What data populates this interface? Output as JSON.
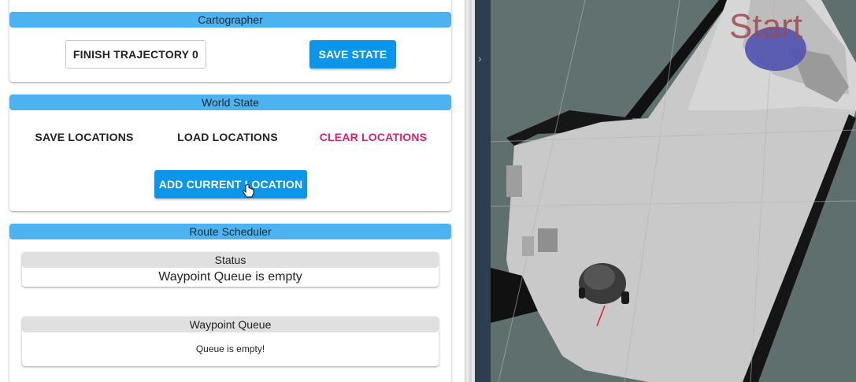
{
  "cartographer": {
    "title": "Cartographer",
    "finish_trajectory_label": "FINISH TRAJECTORY 0",
    "save_state_label": "SAVE STATE"
  },
  "world_state": {
    "title": "World State",
    "save_locations_label": "SAVE LOCATIONS",
    "load_locations_label": "LOAD LOCATIONS",
    "clear_locations_label": "CLEAR LOCATIONS",
    "add_current_location_label": "ADD CURRENT LOCATION"
  },
  "route_scheduler": {
    "title": "Route Scheduler",
    "status": {
      "title": "Status",
      "message": "Waypoint Queue is empty"
    },
    "waypoint_queue": {
      "title": "Waypoint Queue",
      "message": "Queue is empty!"
    }
  },
  "viewer": {
    "start_label": "Start",
    "collapse_icon": "chevron-right-icon"
  },
  "colors": {
    "card_header": "#4db3f0",
    "primary_button": "#0a96eb",
    "danger_text": "#e0215f",
    "sub_header": "#e0e0e0",
    "viewer_sidebar": "#2c3e50",
    "start_marker": "#4f52b0",
    "start_text": "#a0494c"
  }
}
